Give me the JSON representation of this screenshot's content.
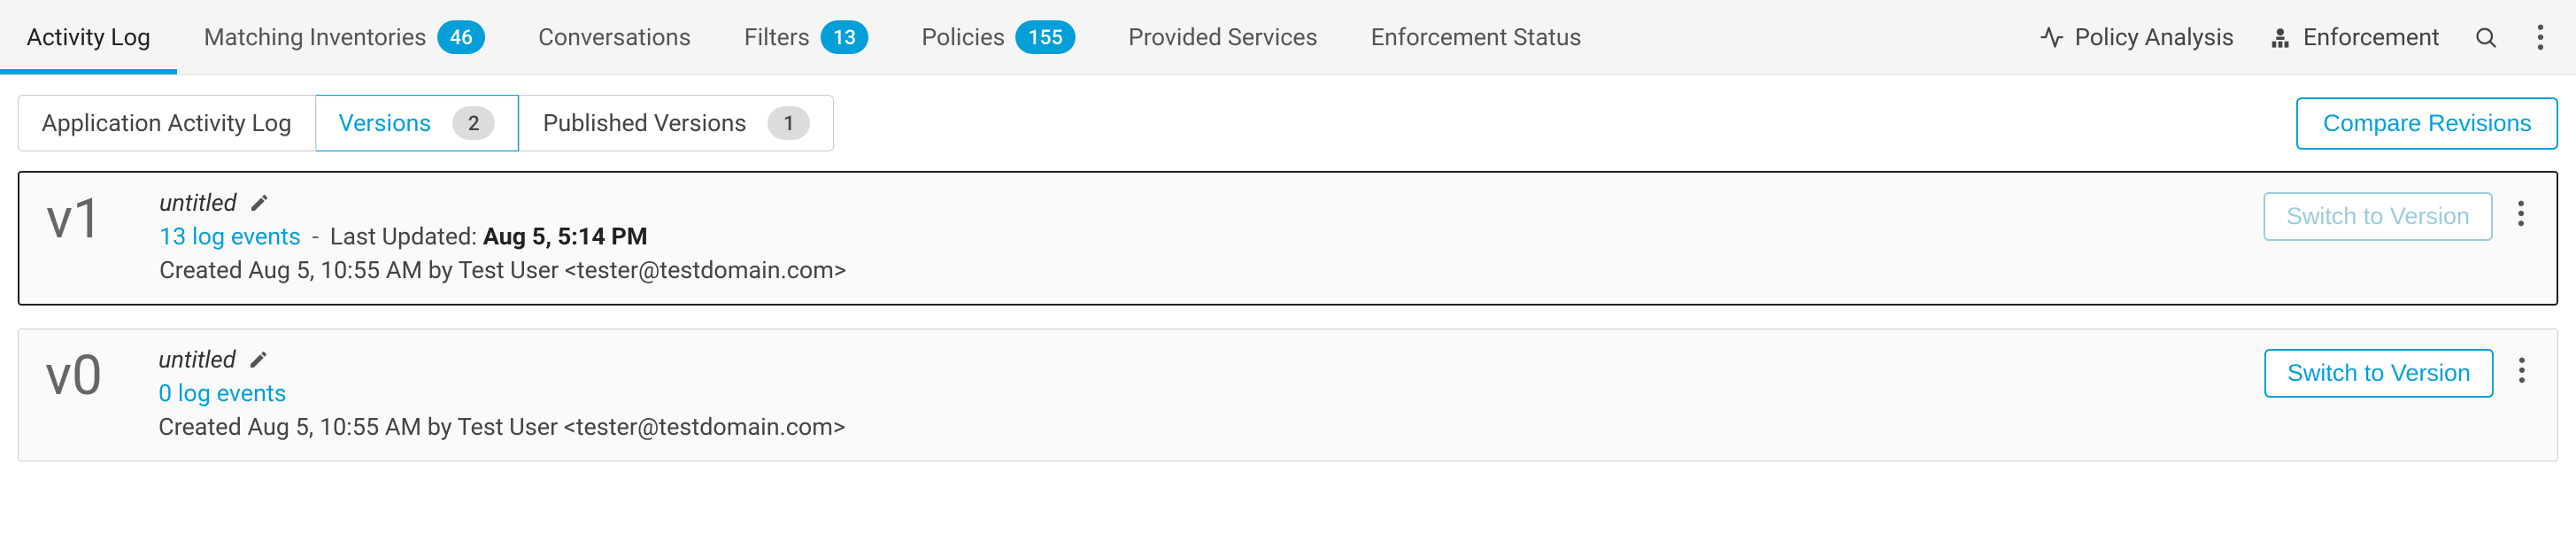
{
  "topnav": {
    "items": [
      {
        "label": "Activity Log",
        "active": true
      },
      {
        "label": "Matching Inventories",
        "badge": "46",
        "badge_color": "blue"
      },
      {
        "label": "Conversations"
      },
      {
        "label": "Filters",
        "badge": "13",
        "badge_color": "blue"
      },
      {
        "label": "Policies",
        "badge": "155",
        "badge_color": "blue"
      },
      {
        "label": "Provided Services"
      },
      {
        "label": "Enforcement Status"
      }
    ],
    "right": {
      "policy_analysis": "Policy Analysis",
      "enforcement": "Enforcement"
    }
  },
  "subtabs": {
    "app_activity_log": "Application Activity Log",
    "versions_label": "Versions",
    "versions_count": "2",
    "published_label": "Published Versions",
    "published_count": "1",
    "compare_btn": "Compare Revisions"
  },
  "versions": [
    {
      "id": "v1",
      "title": "untitled",
      "log_events_text": "13 log events",
      "sep": " - ",
      "updated_label": "Last Updated: ",
      "updated_value": "Aug 5, 5:14 PM",
      "created_text": "Created Aug 5, 10:55 AM by Test User <tester@testdomain.com>",
      "switch_label": "Switch to Version",
      "switch_disabled": true,
      "selected": true
    },
    {
      "id": "v0",
      "title": "untitled",
      "log_events_text": "0 log events",
      "created_text": "Created Aug 5, 10:55 AM by Test User <tester@testdomain.com>",
      "switch_label": "Switch to Version",
      "switch_disabled": false,
      "selected": false
    }
  ]
}
